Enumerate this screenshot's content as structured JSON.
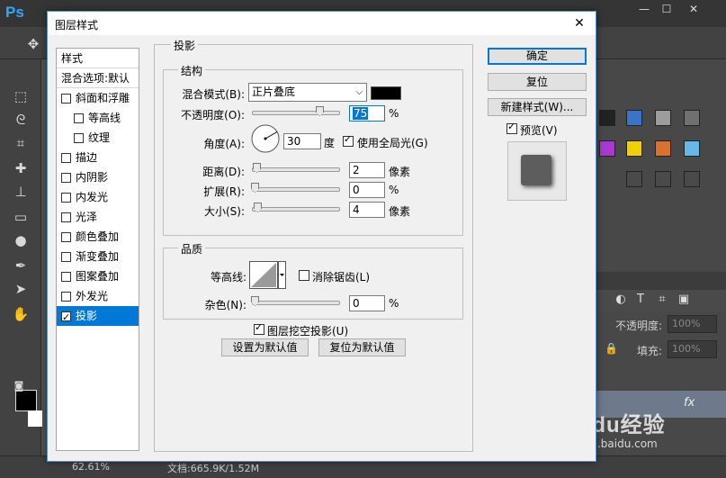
{
  "app": {
    "logo": "Ps",
    "zoom": "62.61%",
    "doc_info": "文档:665.9K/1.52M",
    "opacity_label": "不透明度:",
    "opacity_value": "100%",
    "fill_label": "填充:",
    "fill_value": "100%",
    "fx": "fx"
  },
  "watermark": {
    "brand": "Baidu经验",
    "url": "jingyan.baidu.com"
  },
  "dialog": {
    "title": "图层样式",
    "close": "✕",
    "list_header": "样式",
    "list_blend": "混合选项:默认",
    "styles": [
      {
        "label": "斜面和浮雕",
        "checked": false,
        "indent": false
      },
      {
        "label": "等高线",
        "checked": false,
        "indent": true
      },
      {
        "label": "纹理",
        "checked": false,
        "indent": true
      },
      {
        "label": "描边",
        "checked": false,
        "indent": false
      },
      {
        "label": "内阴影",
        "checked": false,
        "indent": false
      },
      {
        "label": "内发光",
        "checked": false,
        "indent": false
      },
      {
        "label": "光泽",
        "checked": false,
        "indent": false
      },
      {
        "label": "颜色叠加",
        "checked": false,
        "indent": false
      },
      {
        "label": "渐变叠加",
        "checked": false,
        "indent": false
      },
      {
        "label": "图案叠加",
        "checked": false,
        "indent": false
      },
      {
        "label": "外发光",
        "checked": false,
        "indent": false
      },
      {
        "label": "投影",
        "checked": true,
        "indent": false
      }
    ],
    "section_title": "投影",
    "structure": {
      "title": "结构",
      "blend_mode_label": "混合模式(B):",
      "blend_mode_value": "正片叠底",
      "blend_color": "#000000",
      "opacity_label": "不透明度(O):",
      "opacity_value": "75",
      "opacity_unit": "%",
      "angle_label": "角度(A):",
      "angle_value": "30",
      "angle_unit": "度",
      "global_light_label": "使用全局光(G)",
      "global_light_checked": true,
      "distance_label": "距离(D):",
      "distance_value": "2",
      "distance_unit": "像素",
      "spread_label": "扩展(R):",
      "spread_value": "0",
      "spread_unit": "%",
      "size_label": "大小(S):",
      "size_value": "4",
      "size_unit": "像素"
    },
    "quality": {
      "title": "品质",
      "contour_label": "等高线:",
      "antialias_label": "消除锯齿(L)",
      "antialias_checked": false,
      "noise_label": "杂色(N):",
      "noise_value": "0",
      "noise_unit": "%"
    },
    "knockout_label": "图层挖空投影(U)",
    "knockout_checked": true,
    "set_default": "设置为默认值",
    "reset_default": "复位为默认值",
    "ok": "确定",
    "reset": "复位",
    "new_style": "新建样式(W)...",
    "preview_label": "预览(V)",
    "preview_checked": true
  }
}
